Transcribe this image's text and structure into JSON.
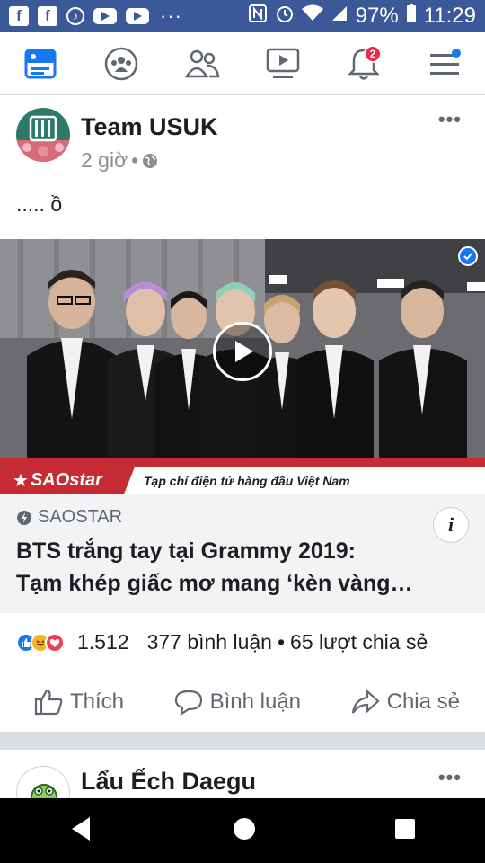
{
  "status_bar": {
    "battery": "97%",
    "time": "11:29",
    "left_icons": [
      "facebook-icon",
      "facebook-icon",
      "tiktok-icon",
      "youtube-icon",
      "youtube-icon"
    ],
    "overflow": "···"
  },
  "nav": {
    "notification_badge": "2",
    "items": [
      "news-feed-icon",
      "groups-icon",
      "friends-icon",
      "watch-icon",
      "notifications-icon",
      "menu-icon"
    ]
  },
  "post1": {
    "author": "Team USUK",
    "time": "2 giờ",
    "separator": "•",
    "text": "..... ồ",
    "link": {
      "banner_brand": "SAOstar",
      "banner_tagline": "Tạp chí điện tử hàng đầu Việt Nam",
      "site": "SAOSTAR",
      "title_line1": "BTS trắng tay tại Grammy 2019:",
      "title_line2": "Tạm khép giấc mơ mang ‘kèn vàng…",
      "info": "i"
    },
    "reactions": {
      "count": "1.512",
      "comments": "377 bình luận",
      "dot": "•",
      "shares": "65 lượt chia sẻ"
    },
    "actions": {
      "like": "Thích",
      "comment": "Bình luận",
      "share": "Chia sẻ"
    }
  },
  "post2": {
    "author": "Lẩu Ếch Daegu",
    "avatar_text": "lẩu ếch"
  },
  "colors": {
    "brand": "#3b5998",
    "accent": "#1877f2",
    "badge": "#f02849",
    "saostar_red": "#c62a33"
  }
}
